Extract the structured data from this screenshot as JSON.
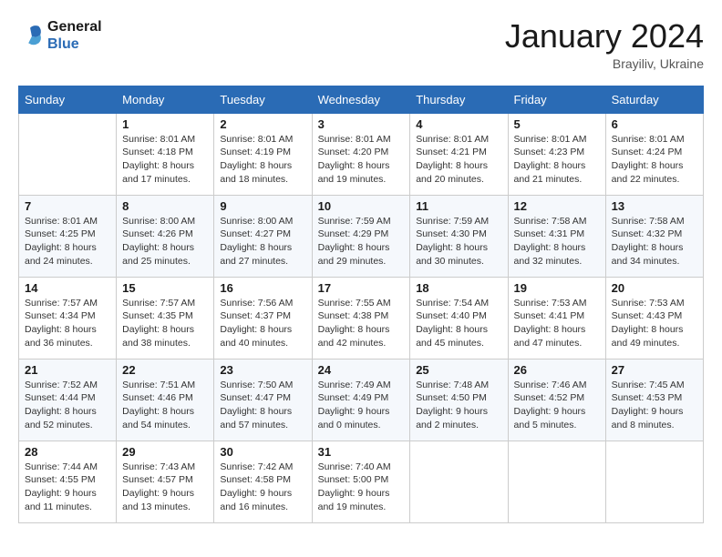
{
  "header": {
    "logo_line1": "General",
    "logo_line2": "Blue",
    "month": "January 2024",
    "location": "Brayiliv, Ukraine"
  },
  "weekdays": [
    "Sunday",
    "Monday",
    "Tuesday",
    "Wednesday",
    "Thursday",
    "Friday",
    "Saturday"
  ],
  "weeks": [
    [
      {
        "day": null
      },
      {
        "day": "1",
        "sunrise": "Sunrise: 8:01 AM",
        "sunset": "Sunset: 4:18 PM",
        "daylight": "Daylight: 8 hours and 17 minutes."
      },
      {
        "day": "2",
        "sunrise": "Sunrise: 8:01 AM",
        "sunset": "Sunset: 4:19 PM",
        "daylight": "Daylight: 8 hours and 18 minutes."
      },
      {
        "day": "3",
        "sunrise": "Sunrise: 8:01 AM",
        "sunset": "Sunset: 4:20 PM",
        "daylight": "Daylight: 8 hours and 19 minutes."
      },
      {
        "day": "4",
        "sunrise": "Sunrise: 8:01 AM",
        "sunset": "Sunset: 4:21 PM",
        "daylight": "Daylight: 8 hours and 20 minutes."
      },
      {
        "day": "5",
        "sunrise": "Sunrise: 8:01 AM",
        "sunset": "Sunset: 4:23 PM",
        "daylight": "Daylight: 8 hours and 21 minutes."
      },
      {
        "day": "6",
        "sunrise": "Sunrise: 8:01 AM",
        "sunset": "Sunset: 4:24 PM",
        "daylight": "Daylight: 8 hours and 22 minutes."
      }
    ],
    [
      {
        "day": "7",
        "sunrise": "Sunrise: 8:01 AM",
        "sunset": "Sunset: 4:25 PM",
        "daylight": "Daylight: 8 hours and 24 minutes."
      },
      {
        "day": "8",
        "sunrise": "Sunrise: 8:00 AM",
        "sunset": "Sunset: 4:26 PM",
        "daylight": "Daylight: 8 hours and 25 minutes."
      },
      {
        "day": "9",
        "sunrise": "Sunrise: 8:00 AM",
        "sunset": "Sunset: 4:27 PM",
        "daylight": "Daylight: 8 hours and 27 minutes."
      },
      {
        "day": "10",
        "sunrise": "Sunrise: 7:59 AM",
        "sunset": "Sunset: 4:29 PM",
        "daylight": "Daylight: 8 hours and 29 minutes."
      },
      {
        "day": "11",
        "sunrise": "Sunrise: 7:59 AM",
        "sunset": "Sunset: 4:30 PM",
        "daylight": "Daylight: 8 hours and 30 minutes."
      },
      {
        "day": "12",
        "sunrise": "Sunrise: 7:58 AM",
        "sunset": "Sunset: 4:31 PM",
        "daylight": "Daylight: 8 hours and 32 minutes."
      },
      {
        "day": "13",
        "sunrise": "Sunrise: 7:58 AM",
        "sunset": "Sunset: 4:32 PM",
        "daylight": "Daylight: 8 hours and 34 minutes."
      }
    ],
    [
      {
        "day": "14",
        "sunrise": "Sunrise: 7:57 AM",
        "sunset": "Sunset: 4:34 PM",
        "daylight": "Daylight: 8 hours and 36 minutes."
      },
      {
        "day": "15",
        "sunrise": "Sunrise: 7:57 AM",
        "sunset": "Sunset: 4:35 PM",
        "daylight": "Daylight: 8 hours and 38 minutes."
      },
      {
        "day": "16",
        "sunrise": "Sunrise: 7:56 AM",
        "sunset": "Sunset: 4:37 PM",
        "daylight": "Daylight: 8 hours and 40 minutes."
      },
      {
        "day": "17",
        "sunrise": "Sunrise: 7:55 AM",
        "sunset": "Sunset: 4:38 PM",
        "daylight": "Daylight: 8 hours and 42 minutes."
      },
      {
        "day": "18",
        "sunrise": "Sunrise: 7:54 AM",
        "sunset": "Sunset: 4:40 PM",
        "daylight": "Daylight: 8 hours and 45 minutes."
      },
      {
        "day": "19",
        "sunrise": "Sunrise: 7:53 AM",
        "sunset": "Sunset: 4:41 PM",
        "daylight": "Daylight: 8 hours and 47 minutes."
      },
      {
        "day": "20",
        "sunrise": "Sunrise: 7:53 AM",
        "sunset": "Sunset: 4:43 PM",
        "daylight": "Daylight: 8 hours and 49 minutes."
      }
    ],
    [
      {
        "day": "21",
        "sunrise": "Sunrise: 7:52 AM",
        "sunset": "Sunset: 4:44 PM",
        "daylight": "Daylight: 8 hours and 52 minutes."
      },
      {
        "day": "22",
        "sunrise": "Sunrise: 7:51 AM",
        "sunset": "Sunset: 4:46 PM",
        "daylight": "Daylight: 8 hours and 54 minutes."
      },
      {
        "day": "23",
        "sunrise": "Sunrise: 7:50 AM",
        "sunset": "Sunset: 4:47 PM",
        "daylight": "Daylight: 8 hours and 57 minutes."
      },
      {
        "day": "24",
        "sunrise": "Sunrise: 7:49 AM",
        "sunset": "Sunset: 4:49 PM",
        "daylight": "Daylight: 9 hours and 0 minutes."
      },
      {
        "day": "25",
        "sunrise": "Sunrise: 7:48 AM",
        "sunset": "Sunset: 4:50 PM",
        "daylight": "Daylight: 9 hours and 2 minutes."
      },
      {
        "day": "26",
        "sunrise": "Sunrise: 7:46 AM",
        "sunset": "Sunset: 4:52 PM",
        "daylight": "Daylight: 9 hours and 5 minutes."
      },
      {
        "day": "27",
        "sunrise": "Sunrise: 7:45 AM",
        "sunset": "Sunset: 4:53 PM",
        "daylight": "Daylight: 9 hours and 8 minutes."
      }
    ],
    [
      {
        "day": "28",
        "sunrise": "Sunrise: 7:44 AM",
        "sunset": "Sunset: 4:55 PM",
        "daylight": "Daylight: 9 hours and 11 minutes."
      },
      {
        "day": "29",
        "sunrise": "Sunrise: 7:43 AM",
        "sunset": "Sunset: 4:57 PM",
        "daylight": "Daylight: 9 hours and 13 minutes."
      },
      {
        "day": "30",
        "sunrise": "Sunrise: 7:42 AM",
        "sunset": "Sunset: 4:58 PM",
        "daylight": "Daylight: 9 hours and 16 minutes."
      },
      {
        "day": "31",
        "sunrise": "Sunrise: 7:40 AM",
        "sunset": "Sunset: 5:00 PM",
        "daylight": "Daylight: 9 hours and 19 minutes."
      },
      {
        "day": null
      },
      {
        "day": null
      },
      {
        "day": null
      }
    ]
  ]
}
